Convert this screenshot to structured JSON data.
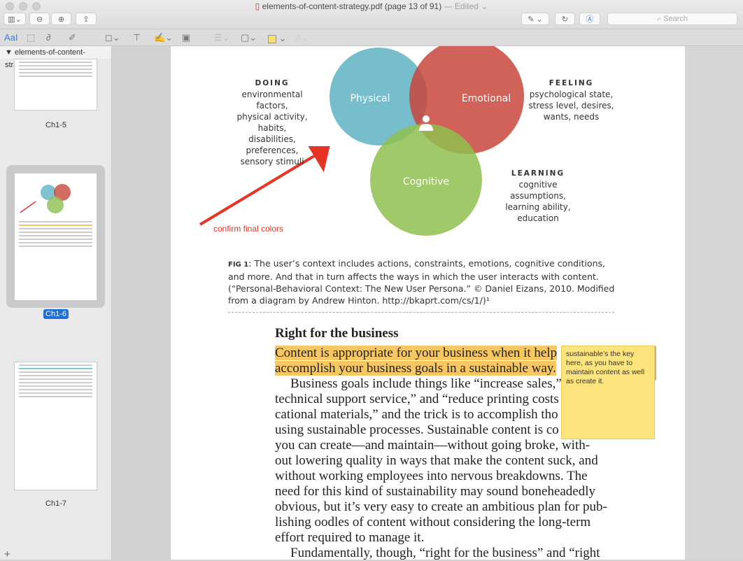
{
  "window": {
    "title": "elements-of-content-strategy.pdf (page 13 of 91)",
    "edited": "— Edited ⌄"
  },
  "toolbar": {
    "sidebar_icon": "sidebar-icon",
    "zoom_out": "zoom-out-icon",
    "zoom_in": "zoom-in-icon",
    "share": "share-icon",
    "markup": "pen-icon",
    "rotate": "rotate-icon",
    "annotate": "markup-circle-icon",
    "search_placeholder": "Search"
  },
  "markup_toolbar": {
    "text_select": "AaI",
    "highlight_color": "#f7df6e"
  },
  "sidebar": {
    "doc_name": "elements-of-content-strategy...",
    "thumbnails": [
      {
        "label": "Ch1-5"
      },
      {
        "label": "Ch1-6",
        "selected": true
      },
      {
        "label": "Ch1-7"
      }
    ]
  },
  "figure": {
    "circles": [
      {
        "label": "Physical",
        "color": "#5fb3c4"
      },
      {
        "label": "Emotional",
        "color": "#c9473d"
      },
      {
        "label": "Cognitive",
        "color": "#8fbf4f"
      }
    ],
    "doing": {
      "title": "DOING",
      "lines": [
        "environmental factors,",
        "physical activity, habits,",
        "disabilities, preferences,",
        "sensory stimuli"
      ]
    },
    "feeling": {
      "title": "FEELING",
      "lines": [
        "psychological state,",
        "stress level, desires,",
        "wants, needs"
      ]
    },
    "learning": {
      "title": "LEARNING",
      "lines": [
        "cognitive assumptions,",
        "learning ability,",
        "education"
      ]
    },
    "annotation": "confirm final colors",
    "caption_label": "FIG 1",
    "caption": ": The user’s context includes actions, constraints, emotions, cognitive conditions, and more. And that in turn affects the ways in which the user interacts with content. (“Personal-Behavioral Context: The New User Persona.” © Daniel Eizans, 2010. Modified from a diagram by Andrew Hinton. http://bkaprt.com/cs/1/)¹"
  },
  "body": {
    "heading": "Right for the business",
    "highlight_lines": [
      "Content is appropriate for your business when it help",
      "accomplish your business goals in a sustainable way."
    ],
    "lines": [
      "Business goals include things like “increase sales,”",
      "technical support service,” and “reduce printing costs",
      "cational materials,” and the trick is to accomplish tho",
      "using sustainable processes. Sustainable content is co",
      "you can create—and maintain—without going broke, with-",
      "out lowering quality in ways that make the content suck, and",
      "without working employees into nervous breakdowns. The",
      "need for this kind of sustainability may sound boneheadedly",
      "obvious, but it’s very easy to create an ambitious plan for pub-",
      "lishing oodles of content without considering the long-term",
      "effort required to manage it.",
      "Fundamentally, though, “right for the business” and “right"
    ],
    "note": "sustainable’s the key here, as you have to maintain content as well as create it."
  },
  "footer": {
    "add": "+"
  }
}
